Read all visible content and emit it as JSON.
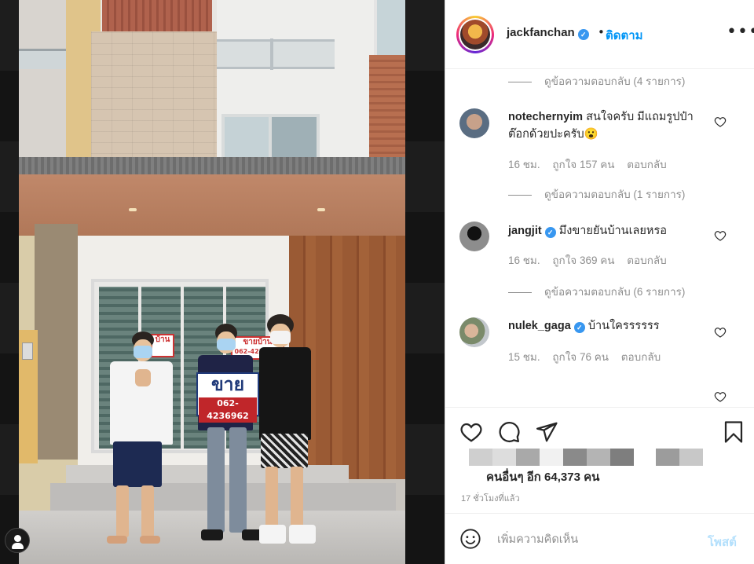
{
  "post": {
    "username": "jackfanchan",
    "separator": "•",
    "follow_label": "ติดตาม",
    "sign_big": "ขาย",
    "sign_phone": "062-4236962",
    "door_sign_1": "ขายบ้าน",
    "door_sign_1_phone": "062-4236962",
    "door_sign_2": "บ้าน",
    "door_sign_2_phone": "2-4236962"
  },
  "comments": {
    "replies_top": "ดูข้อความตอบกลับ (4 รายการ)",
    "items": [
      {
        "username": "notechernyim",
        "text": "สนใจครับ มีแถมรูปป๋าต๊อกด้วยปะครับ😮",
        "time": "16 ชม.",
        "likes": "ถูกใจ 157 คน",
        "reply": "ตอบกลับ",
        "view_replies": "ดูข้อความตอบกลับ (1 รายการ)",
        "avatar_color": "#5a6d82"
      },
      {
        "username": "jangjit",
        "text": "มึงขายยันบ้านเลยหรอ",
        "time": "16 ชม.",
        "likes": "ถูกใจ 369 คน",
        "reply": "ตอบกลับ",
        "view_replies": "ดูข้อความตอบกลับ (6 รายการ)",
        "avatar_color": "#3a3a3a"
      },
      {
        "username": "nulek_gaga",
        "text": "บ้านใครรรรรร",
        "time": "15 ชม.",
        "likes": "ถูกใจ 76 คน",
        "reply": "ตอบกลับ",
        "avatar_color": "#9a8a6a"
      }
    ]
  },
  "footer": {
    "likes_text": "คนอื่นๆ อีก 64,373 คน",
    "time_ago": "17 ชั่วโมงที่แล้ว",
    "comment_placeholder": "เพิ่มความคิดเห็น",
    "post_label": "โพสต์"
  },
  "colors": {
    "accent": "#0095f6",
    "post_disabled": "#b2dffc",
    "muted_text": "#8e8e8e",
    "verified": "#3897f0"
  },
  "icons": [
    "heart-icon",
    "comment-icon",
    "share-icon",
    "bookmark-icon",
    "more-icon",
    "emoji-icon",
    "verified-icon",
    "user-tag-icon"
  ]
}
